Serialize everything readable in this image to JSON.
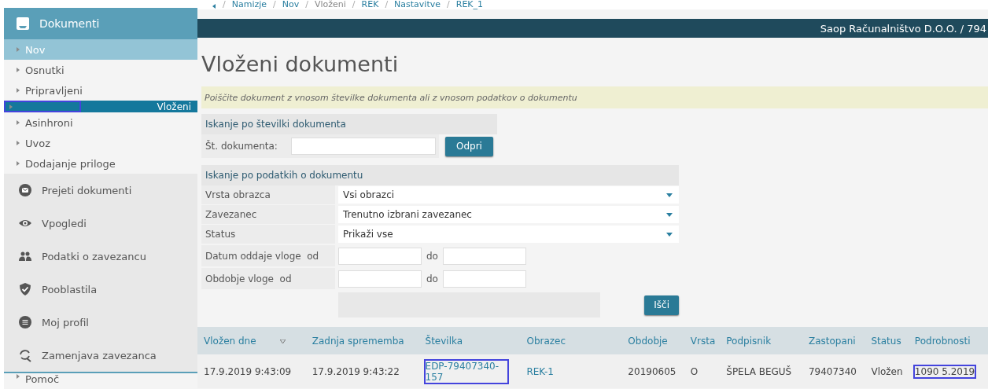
{
  "sidebar": {
    "header": "Dokumenti",
    "items": [
      {
        "label": "Nov",
        "selected": false,
        "current_section": true,
        "highlight": false
      },
      {
        "label": "Osnutki",
        "selected": false,
        "current_section": false,
        "highlight": false
      },
      {
        "label": "Pripravljeni",
        "selected": false,
        "current_section": false,
        "highlight": false
      },
      {
        "label": "Vloženi",
        "selected": true,
        "current_section": false,
        "highlight": true
      },
      {
        "label": "Asinhroni",
        "selected": false,
        "current_section": false,
        "highlight": false
      },
      {
        "label": "Uvoz",
        "selected": false,
        "current_section": false,
        "highlight": false
      },
      {
        "label": "Dodajanje priloge",
        "selected": false,
        "current_section": false,
        "highlight": false
      }
    ],
    "sections": [
      {
        "label": "Prejeti dokumenti",
        "kind": "mail"
      },
      {
        "label": "Vpogledi",
        "kind": "eye"
      },
      {
        "label": "Podatki o zavezancu",
        "kind": "people"
      },
      {
        "label": "Pooblastila",
        "kind": "shield"
      },
      {
        "label": "Moj profil",
        "kind": "list"
      },
      {
        "label": "Zamenjava zavezanca",
        "kind": "swap"
      }
    ],
    "footer_item": "Pomoč"
  },
  "breadcrumb": [
    {
      "separator": "/",
      "label": "Namizje",
      "current": false
    },
    {
      "separator": "/",
      "label": "Nov",
      "current": false
    },
    {
      "separator": "/",
      "label": "Vloženi",
      "current": true
    },
    {
      "separator": "/",
      "label": "REK",
      "current": false
    },
    {
      "separator": "/",
      "label": "Nastavitve",
      "current": false
    },
    {
      "separator": "/",
      "label": "REK_1",
      "current": false
    }
  ],
  "top_bar": {
    "account": "Saop Računalništvo D.O.O. / 794"
  },
  "page_title": "Vloženi dokumenti",
  "info": "Poiščite dokument z vnosom številke dokumenta ali z vnosom podatkov o dokumentu",
  "number_search": {
    "title": "Iskanje po številki dokumenta",
    "label": "Št. dokumenta:",
    "button": "Odpri"
  },
  "data_search": {
    "title": "Iskanje po podatkih o dokumentu",
    "fields": [
      {
        "label": "Vrsta obrazca",
        "kind": "select",
        "value": "Vsi obrazci"
      },
      {
        "label": "Zavezanec",
        "kind": "select",
        "value": "Trenutno izbrani zavezanec"
      },
      {
        "label": "Status",
        "kind": "select",
        "value": "Prikaži vse"
      },
      {
        "label": "Datum oddaje vloge  od",
        "kind": "range",
        "to_label": "do"
      },
      {
        "label": "Obdobje vloge  od",
        "kind": "range",
        "to_label": "do"
      }
    ],
    "button": "Išči"
  },
  "table": {
    "columns": [
      {
        "label": "Vložen dne",
        "sorted": true
      },
      {
        "label": "Zadnja sprememba",
        "sorted": false
      },
      {
        "label": "Številka",
        "sorted": false
      },
      {
        "label": "Obrazec",
        "sorted": false
      },
      {
        "label": "Obdobje",
        "sorted": false
      },
      {
        "label": "Vrsta",
        "sorted": false
      },
      {
        "label": "Podpisnik",
        "sorted": false
      },
      {
        "label": "Zastopani",
        "sorted": false
      },
      {
        "label": "Status",
        "sorted": false
      },
      {
        "label": "Podrobnosti",
        "sorted": false
      }
    ],
    "rows": [
      {
        "cells": [
          {
            "text": "17.9.2019 9:43:09",
            "link": false,
            "highlight": false
          },
          {
            "text": "17.9.2019 9:43:22",
            "link": false,
            "highlight": false
          },
          {
            "text": "EDP-79407340-157",
            "link": true,
            "highlight": true
          },
          {
            "text": "REK-1",
            "link": true,
            "highlight": false
          },
          {
            "text": "20190605",
            "link": false,
            "highlight": false
          },
          {
            "text": "O",
            "link": false,
            "highlight": false
          },
          {
            "text": "ŠPELA BEGUŠ",
            "link": false,
            "highlight": false
          },
          {
            "text": "79407340",
            "link": false,
            "highlight": false
          },
          {
            "text": "Vložen",
            "link": false,
            "highlight": false
          },
          {
            "text": "1090 5.2019",
            "link": false,
            "highlight": true
          }
        ]
      }
    ]
  }
}
